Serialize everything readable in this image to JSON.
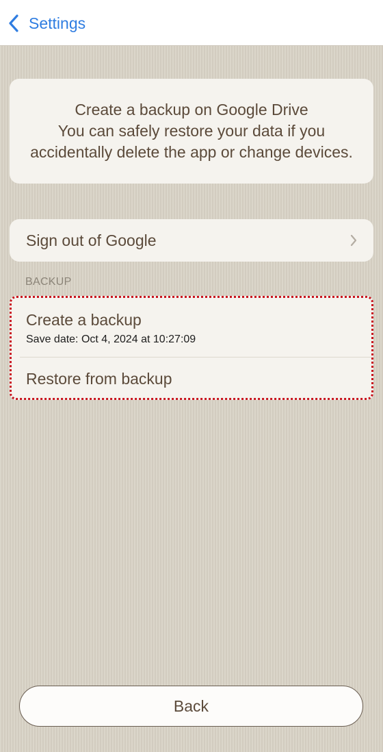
{
  "nav": {
    "back_label": "Settings",
    "back_icon": "chevron-left-icon",
    "accent_color": "#2f7de1"
  },
  "info": {
    "title": "Create a backup on Google Drive",
    "description": "You can safely restore your data if you accidentally delete the app or change devices."
  },
  "google": {
    "sign_out_label": "Sign out of Google",
    "chevron_icon": "chevron-right-icon"
  },
  "backup": {
    "section_header": "BACKUP",
    "create_label": "Create a backup",
    "save_date": "Save date: Oct 4, 2024 at 10:27:09",
    "restore_label": "Restore from backup",
    "highlight_color": "#c8141e"
  },
  "footer": {
    "back_button_label": "Back"
  },
  "colors": {
    "background": "#d7d1c4",
    "card": "#f5f3ee",
    "text": "#5b4a3a"
  }
}
